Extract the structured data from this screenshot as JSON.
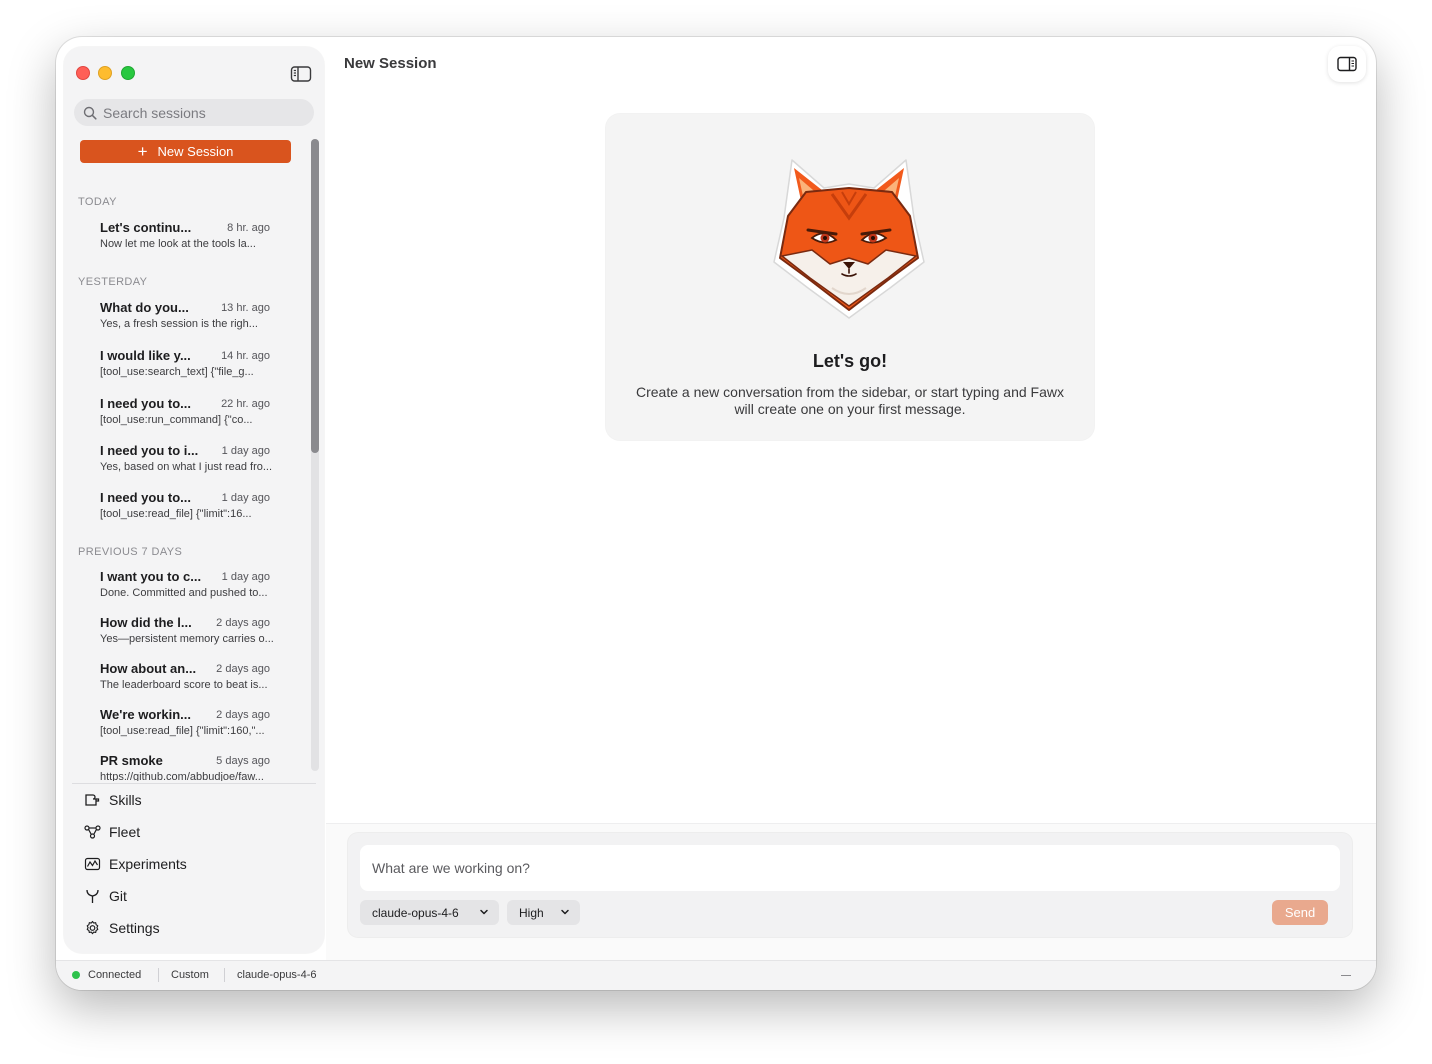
{
  "sidebar": {
    "search_placeholder": "Search sessions",
    "new_session_label": "New Session",
    "groups": [
      {
        "label": "TODAY",
        "sessions": [
          {
            "title": "Let's continu...",
            "time": "8 hr. ago",
            "preview": "Now let me look at the tools la..."
          }
        ]
      },
      {
        "label": "YESTERDAY",
        "sessions": [
          {
            "title": "What do you...",
            "time": "13 hr. ago",
            "preview": "Yes, a fresh session is the righ..."
          },
          {
            "title": "I would like y...",
            "time": "14 hr. ago",
            "preview": "[tool_use:search_text] {\"file_g..."
          },
          {
            "title": "I need you to...",
            "time": "22 hr. ago",
            "preview": "[tool_use:run_command] {\"co..."
          },
          {
            "title": "I need you to i...",
            "time": "1 day ago",
            "preview": "Yes, based on what I just read fro..."
          },
          {
            "title": "I need you to...",
            "time": "1 day ago",
            "preview": "[tool_use:read_file] {\"limit\":16..."
          }
        ]
      },
      {
        "label": "PREVIOUS 7 DAYS",
        "sessions": [
          {
            "title": "I want you to c...",
            "time": "1 day ago",
            "preview": "Done. Committed and pushed to..."
          },
          {
            "title": "How did the l...",
            "time": "2 days ago",
            "preview": "Yes—persistent memory carries o..."
          },
          {
            "title": "How about an...",
            "time": "2 days ago",
            "preview": "The leaderboard score to beat is..."
          },
          {
            "title": "We're workin...",
            "time": "2 days ago",
            "preview": "[tool_use:read_file] {\"limit\":160,\"..."
          },
          {
            "title": "PR smoke",
            "time": "5 days ago",
            "preview": "https://github.com/abbudjoe/faw..."
          }
        ]
      }
    ],
    "nav": [
      {
        "label": "Skills",
        "icon": "skills-icon"
      },
      {
        "label": "Fleet",
        "icon": "fleet-icon"
      },
      {
        "label": "Experiments",
        "icon": "experiments-icon"
      },
      {
        "label": "Git",
        "icon": "git-icon"
      },
      {
        "label": "Settings",
        "icon": "gear-icon"
      }
    ]
  },
  "main": {
    "title": "New Session",
    "welcome": {
      "title": "Let's go!",
      "body": "Create a new conversation from the sidebar, or start typing and Fawx will create one on your first message."
    },
    "composer": {
      "placeholder": "What are we working on?",
      "model": "claude-opus-4-6",
      "effort": "High",
      "send_label": "Send"
    }
  },
  "statusbar": {
    "status": "Connected",
    "mode": "Custom",
    "model": "claude-opus-4-6"
  },
  "colors": {
    "accent": "#d9541e",
    "send_disabled": "#e9a98e",
    "connected": "#2ec24c"
  }
}
